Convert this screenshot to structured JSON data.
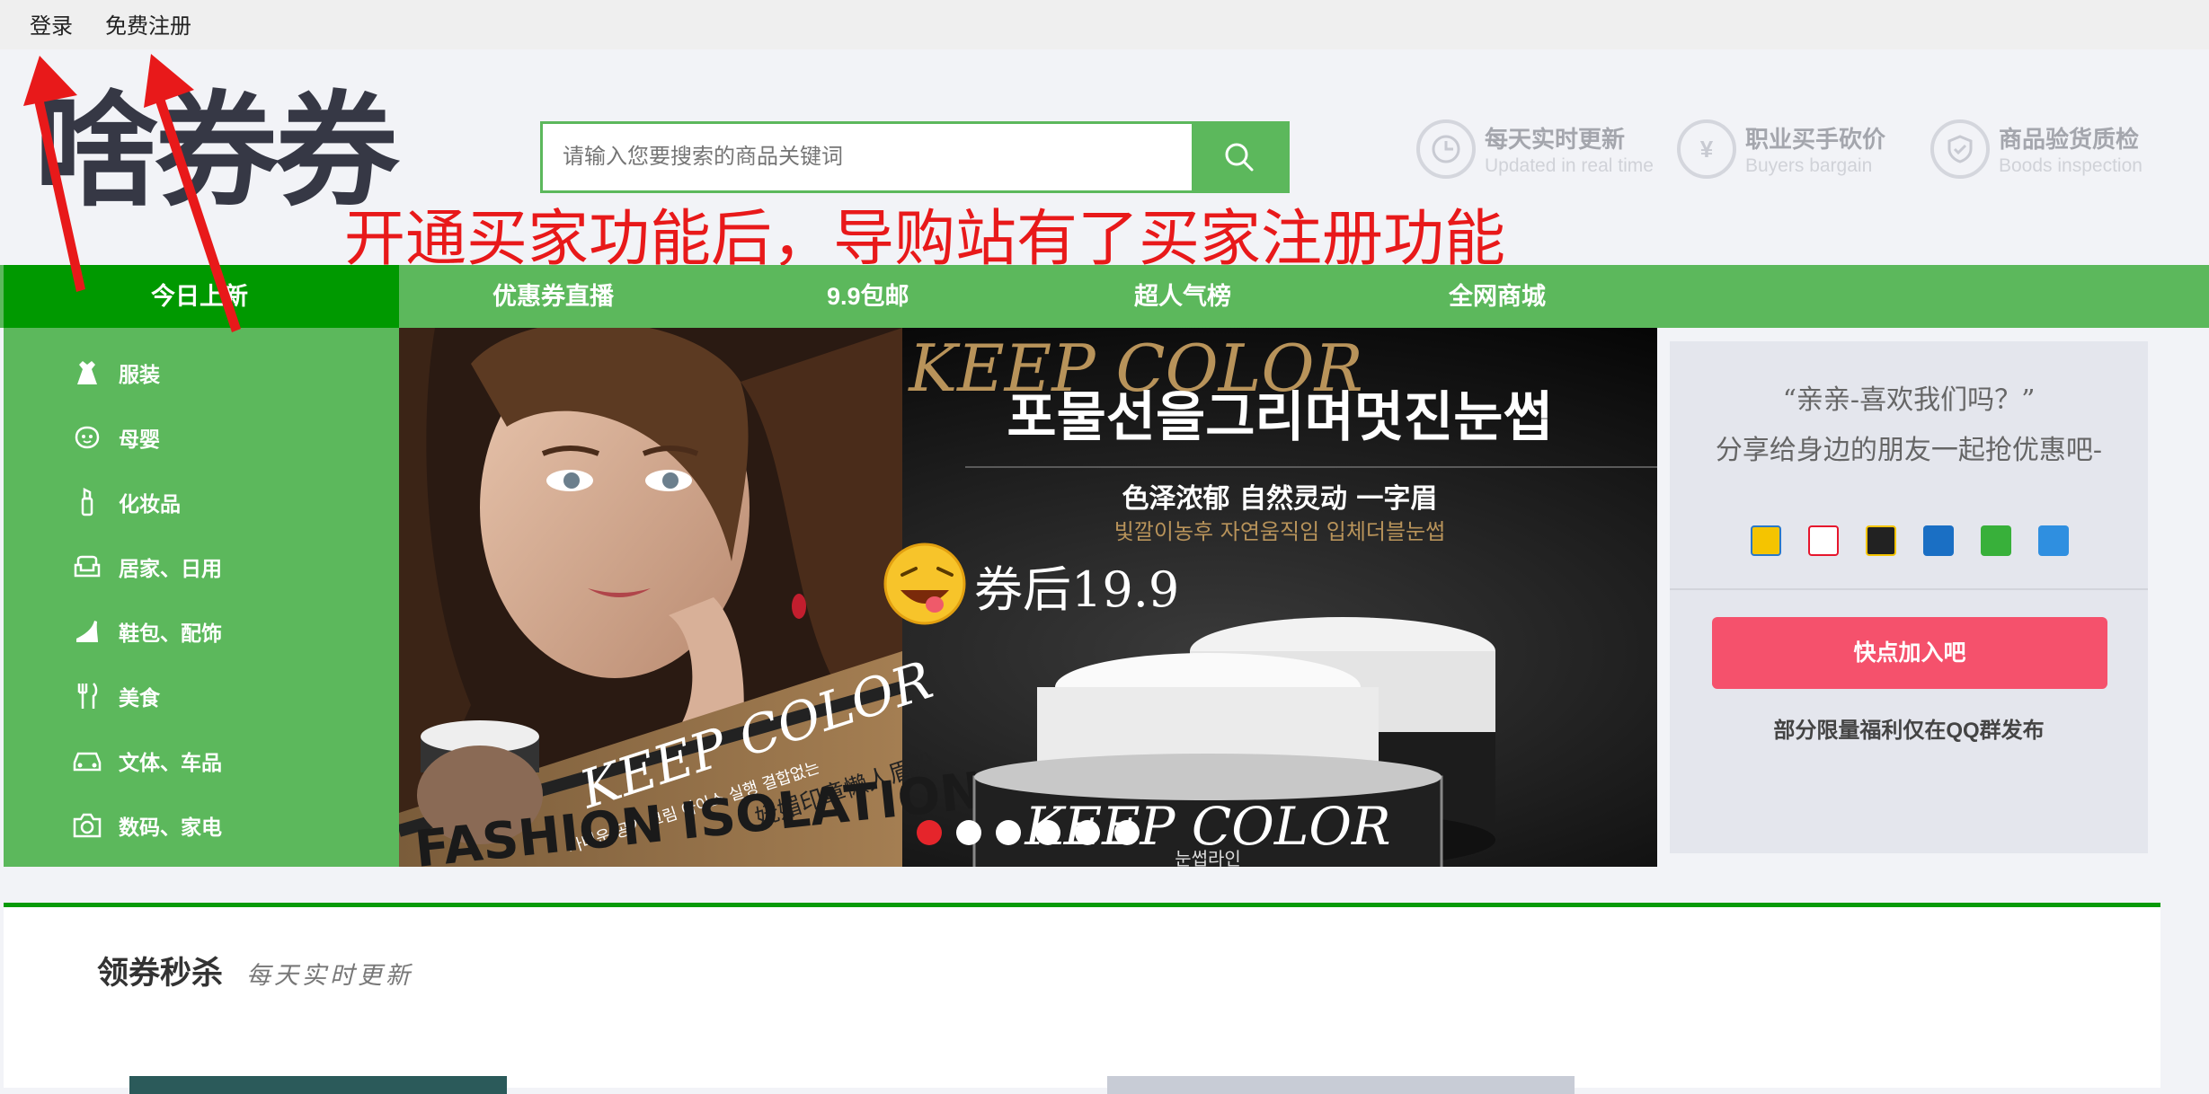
{
  "topbar": {
    "login": "登录",
    "register": "免费注册"
  },
  "logo": "啥券券",
  "search": {
    "placeholder": "请输入您要搜索的商品关键词"
  },
  "features": [
    {
      "icon": "clock-icon",
      "title": "每天实时更新",
      "subtitle": "Updated in real time"
    },
    {
      "icon": "yen-icon",
      "title": "职业买手砍价",
      "subtitle": "Buyers bargain"
    },
    {
      "icon": "shield-check-icon",
      "title": "商品验货质检",
      "subtitle": "Boods inspection"
    }
  ],
  "annotation": "开通买家功能后，导购站有了买家注册功能",
  "nav": {
    "items": [
      "今日上新",
      "优惠券直播",
      "9.9包邮",
      "超人气榜",
      "全网商城"
    ]
  },
  "sidebar": {
    "items": [
      {
        "label": "服装",
        "icon": "dress-icon"
      },
      {
        "label": "母婴",
        "icon": "baby-icon"
      },
      {
        "label": "化妆品",
        "icon": "lipstick-icon"
      },
      {
        "label": "居家、日用",
        "icon": "sofa-icon"
      },
      {
        "label": "鞋包、配饰",
        "icon": "heel-icon"
      },
      {
        "label": "美食",
        "icon": "fork-knife-icon"
      },
      {
        "label": "文体、车品",
        "icon": "car-icon"
      },
      {
        "label": "数码、家电",
        "icon": "camera-icon"
      }
    ]
  },
  "banner": {
    "brand": "KEEP COLOR",
    "korean_title": "포물선을그리며멋진눈썹",
    "chinese_tagline": "色泽浓郁 自然灵动 一字眉",
    "korean_sub": "빛깔이농후 자연움직임 입체더블눈썹",
    "price": "券后19.9",
    "left_korean": "가벼운 공기 크림 아이스 실행 결합없는",
    "left_chinese": "妩媚印章懒人眉粉",
    "bottom_text": "FASHION ISOLATION",
    "jar_label": "눈썹라인",
    "dots": 6,
    "active_dot": 1
  },
  "promo": {
    "line1": "“亲亲-喜欢我们吗？”",
    "line2": "分享给身边的朋友一起抢优惠吧-",
    "shares": [
      "qzone-icon",
      "weibo-icon",
      "qq-icon",
      "renren-icon",
      "wechat-icon",
      "more-icon"
    ],
    "join": "快点加入吧",
    "qq_note": "部分限量福利仅在QQ群发布"
  },
  "section": {
    "title": "领券秒杀",
    "subtitle": "每天实时更新"
  },
  "colors": {
    "green": "#5cb85c",
    "dark_green": "#009900",
    "pink": "#f5516c",
    "red": "#e8191a"
  }
}
